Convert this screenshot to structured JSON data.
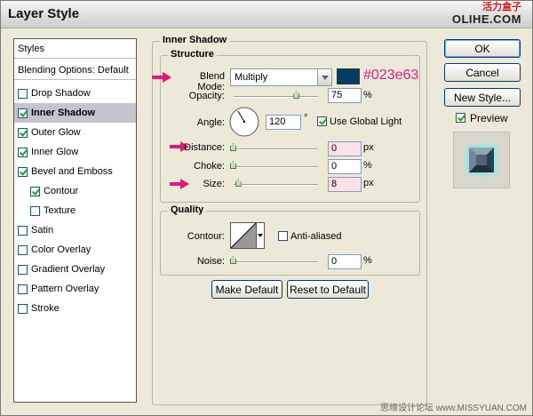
{
  "window": {
    "title": "Layer Style"
  },
  "watermark": {
    "top_cn": "活力盒子",
    "top_en": "OLIHE.COM",
    "bottom": "思缘设计论坛 www.MISSYUAN.COM"
  },
  "styles_list": {
    "header": "Styles",
    "blending": "Blending Options: Default",
    "items": [
      {
        "label": "Drop Shadow",
        "checked": false,
        "selected": false
      },
      {
        "label": "Inner Shadow",
        "checked": true,
        "selected": true
      },
      {
        "label": "Outer Glow",
        "checked": true,
        "selected": false
      },
      {
        "label": "Inner Glow",
        "checked": true,
        "selected": false
      },
      {
        "label": "Bevel and Emboss",
        "checked": true,
        "selected": false
      },
      {
        "label": "Contour",
        "checked": true,
        "selected": false
      },
      {
        "label": "Texture",
        "checked": false,
        "selected": false
      },
      {
        "label": "Satin",
        "checked": false,
        "selected": false
      },
      {
        "label": "Color Overlay",
        "checked": false,
        "selected": false
      },
      {
        "label": "Gradient Overlay",
        "checked": false,
        "selected": false
      },
      {
        "label": "Pattern Overlay",
        "checked": false,
        "selected": false
      },
      {
        "label": "Stroke",
        "checked": false,
        "selected": false
      }
    ]
  },
  "inner_shadow": {
    "title": "Inner Shadow",
    "structure_title": "Structure",
    "blend_mode_label": "Blend Mode:",
    "blend_mode_value": "Multiply",
    "color_swatch": "#023e63",
    "color_annotation": "#023e63",
    "opacity_label": "Opacity:",
    "opacity_value": "75",
    "opacity_level": 0.75,
    "pct": "%",
    "px": "px",
    "angle_label": "Angle:",
    "angle_value": "120",
    "angle_degrees": 120,
    "degree_symbol": "°",
    "use_global_light_label": "Use Global Light",
    "use_global_light_checked": true,
    "distance_label": "Distance:",
    "distance_value": "0",
    "distance_level": 0,
    "choke_label": "Choke:",
    "choke_value": "0",
    "choke_level": 0,
    "size_label": "Size:",
    "size_value": "8",
    "size_level": 0.06,
    "quality_title": "Quality",
    "contour_label": "Contour:",
    "anti_aliased_label": "Anti-aliased",
    "anti_aliased_checked": false,
    "noise_label": "Noise:",
    "noise_value": "0",
    "noise_level": 0,
    "make_default": "Make Default",
    "reset_default": "Reset to Default"
  },
  "buttons": {
    "ok": "OK",
    "cancel": "Cancel",
    "new_style": "New Style...",
    "preview_label": "Preview",
    "preview_checked": true
  },
  "colors": {
    "arrow": "#ee1177",
    "annotation": "#e0207c",
    "preview_glow": "#7ee8ef"
  }
}
